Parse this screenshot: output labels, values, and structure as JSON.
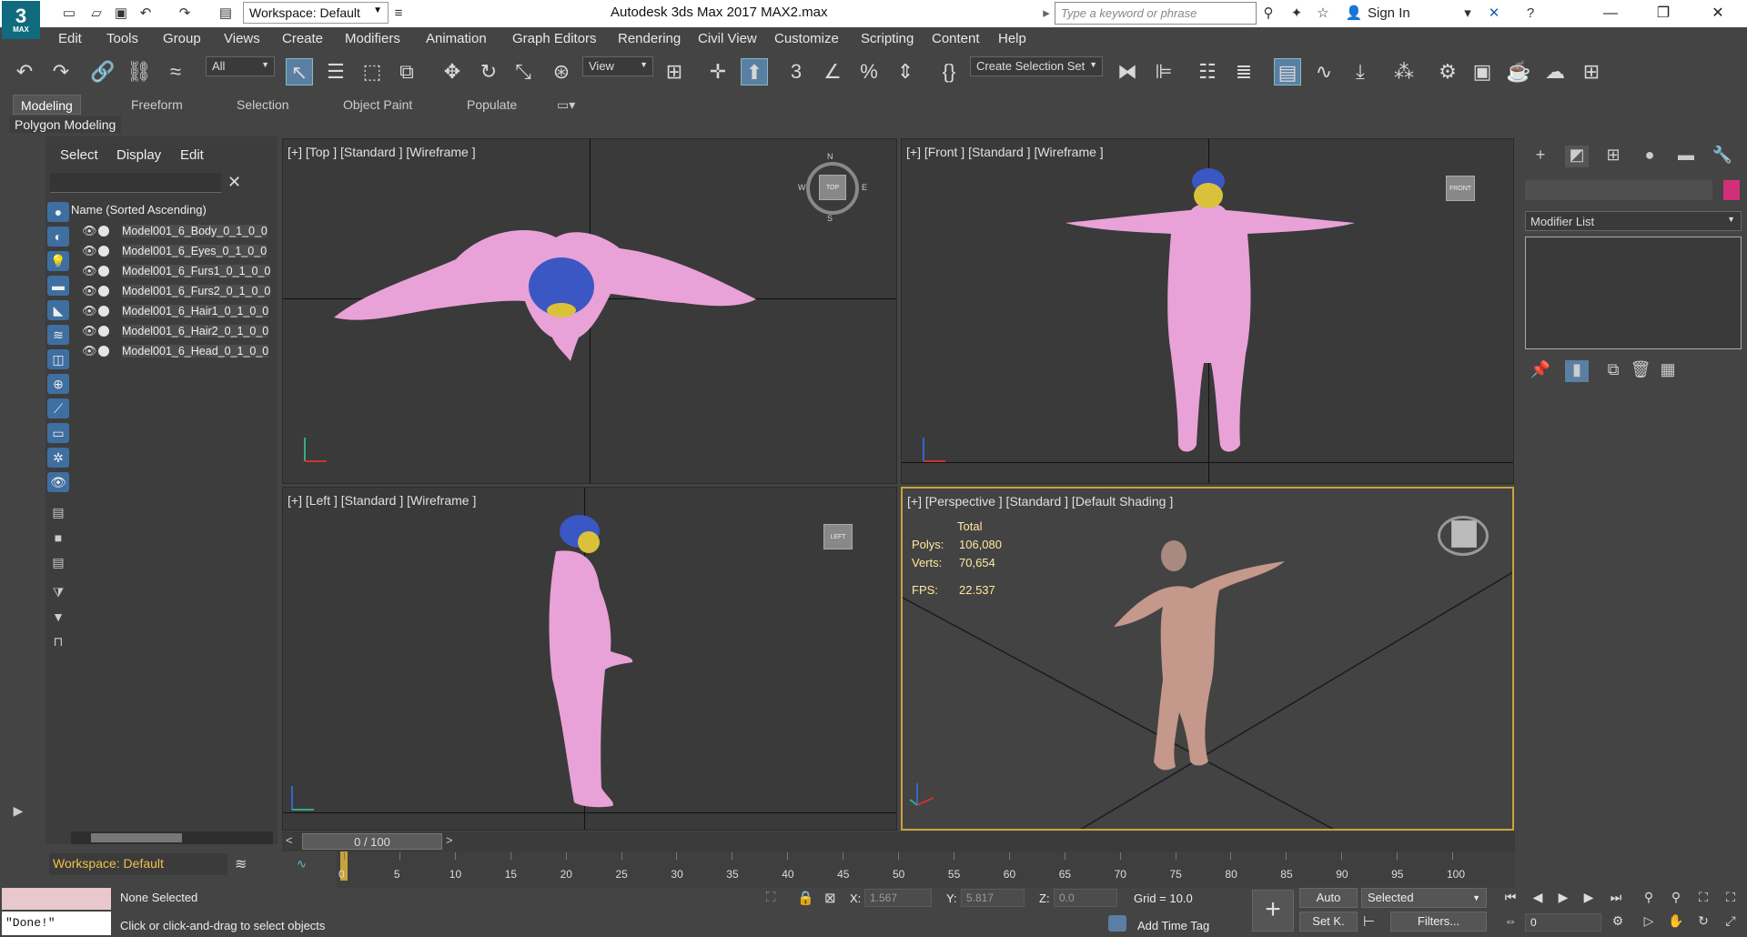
{
  "titlebar": {
    "logo": "3",
    "logo_sub": "MAX",
    "workspace": "Workspace: Default",
    "app_title": "Autodesk 3ds Max 2017      MAX2.max",
    "search_placeholder": "Type a keyword or phrase",
    "sign_in": "Sign In"
  },
  "menu": [
    "Edit",
    "Tools",
    "Group",
    "Views",
    "Create",
    "Modifiers",
    "Animation",
    "Graph Editors",
    "Rendering",
    "Civil View",
    "Customize",
    "Scripting",
    "Content",
    "Help"
  ],
  "toolbar": {
    "filter_drop": "All",
    "refcoord_drop": "View",
    "selection_set_drop": "Create Selection Set"
  },
  "ribbon": {
    "tabs": [
      "Modeling",
      "Freeform",
      "Selection",
      "Object Paint",
      "Populate"
    ],
    "active_tab": "Modeling",
    "panel_label": "Polygon Modeling"
  },
  "scene_explorer": {
    "tabs": [
      "Select",
      "Display",
      "Edit"
    ],
    "header": "Name (Sorted Ascending)",
    "objects": [
      "Model001_6_Body_0_1_0_0",
      "Model001_6_Eyes_0_1_0_0",
      "Model001_6_Furs1_0_1_0_0",
      "Model001_6_Furs2_0_1_0_0",
      "Model001_6_Hair1_0_1_0_0",
      "Model001_6_Hair2_0_1_0_0",
      "Model001_6_Head_0_1_0_0"
    ],
    "workspace": "Workspace: Default"
  },
  "viewports": {
    "top": "[+] [Top ] [Standard ] [Wireframe ]",
    "front": "[+] [Front ] [Standard ] [Wireframe ]",
    "left": "[+] [Left ] [Standard ] [Wireframe ]",
    "perspective": "[+] [Perspective ] [Standard ] [Default Shading ]",
    "cube_top": "TOP",
    "cube_front": "FRONT",
    "cube_left": "LEFT",
    "compass": {
      "n": "N",
      "s": "S",
      "e": "E",
      "w": "W"
    }
  },
  "stats": {
    "total_label": "Total",
    "polys_label": "Polys:",
    "polys": "106,080",
    "verts_label": "Verts:",
    "verts": "70,654",
    "fps_label": "FPS:",
    "fps": "22.537"
  },
  "command_panel": {
    "modifier_list": "Modifier List",
    "object_color": "#d0307a"
  },
  "timeline": {
    "position": "0 / 100",
    "ticks": [
      "0",
      "5",
      "10",
      "15",
      "20",
      "25",
      "30",
      "35",
      "40",
      "45",
      "50",
      "55",
      "60",
      "65",
      "70",
      "75",
      "80",
      "85",
      "90",
      "95",
      "100"
    ],
    "frame_value": "0"
  },
  "status": {
    "maxscript_output": "\"Done!\"",
    "selection": "None Selected",
    "prompt": "Click or click-and-drag to select objects",
    "x_label": "X:",
    "x_value": "1.567",
    "y_label": "Y:",
    "y_value": "5.817",
    "z_label": "Z:",
    "z_value": "0.0",
    "grid": "Grid = 10.0",
    "add_time_tag": "Add Time Tag",
    "auto": "Auto",
    "set_key": "Set K.",
    "selected_drop": "Selected",
    "filters": "Filters..."
  },
  "colors": {
    "accent": "#5a7fa3",
    "viewport_active_border": "#c9a23a",
    "wireframe_pink": "#e8a2d8",
    "stats_text": "#ffe9a0"
  }
}
